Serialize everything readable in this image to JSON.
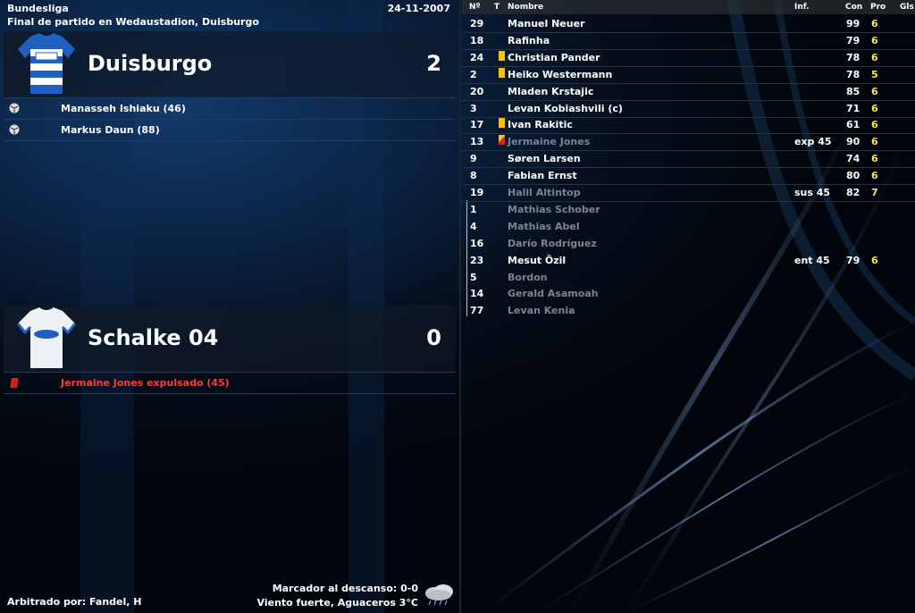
{
  "competition": "Bundesliga",
  "date": "24-11-2007",
  "subtitle": "Final de partido en Wedaustadion, Duisburgo",
  "home": {
    "name": "Duisburgo",
    "score": "2",
    "events": [
      {
        "icon": "ball-icon",
        "text": "Manasseh Ishiaku (46)"
      },
      {
        "icon": "ball-icon",
        "text": "Markus Daun (88)"
      }
    ]
  },
  "away": {
    "name": "Schalke 04",
    "score": "0",
    "events": [
      {
        "icon": "red-card-icon",
        "text": "Jermaine Jones expulsado (45)"
      }
    ]
  },
  "footer": {
    "referee": "Arbitrado por: Fandel, H",
    "halftime": "Marcador al descanso: 0-0",
    "weather": "Viento fuerte, Aguaceros 3°C",
    "weather_icon": "rain-cloud-icon"
  },
  "colors": {
    "red_text": "#ff3b2f",
    "rating": "#ffe84a"
  },
  "table": {
    "headers": {
      "num": "Nº",
      "t": "T",
      "name": "Nombre",
      "inf": "Inf.",
      "con": "Con",
      "pro": "Pro",
      "gls": "Gls"
    },
    "rows": [
      {
        "num": "29",
        "card": "",
        "name": "Manuel Neuer",
        "inf": "",
        "con": "99",
        "pro": "6",
        "dim": false
      },
      {
        "num": "18",
        "card": "",
        "name": "Rafinha",
        "inf": "",
        "con": "79",
        "pro": "6",
        "dim": false
      },
      {
        "num": "24",
        "card": "yellow",
        "name": "Christian Pander",
        "inf": "",
        "con": "78",
        "pro": "6",
        "dim": false
      },
      {
        "num": "2",
        "card": "yellow",
        "name": "Heiko Westermann",
        "inf": "",
        "con": "78",
        "pro": "5",
        "dim": false
      },
      {
        "num": "20",
        "card": "",
        "name": "Mladen Krstajic",
        "inf": "",
        "con": "85",
        "pro": "6",
        "dim": false
      },
      {
        "num": "3",
        "card": "",
        "name": "Levan Kobiashvili (c)",
        "inf": "",
        "con": "71",
        "pro": "6",
        "dim": false
      },
      {
        "num": "17",
        "card": "yellow",
        "name": "Ivan Rakitic",
        "inf": "",
        "con": "61",
        "pro": "6",
        "dim": false
      },
      {
        "num": "13",
        "card": "red",
        "name": "Jermaine Jones",
        "inf": "exp 45",
        "con": "90",
        "pro": "6",
        "dim": true
      },
      {
        "num": "9",
        "card": "",
        "name": "Søren Larsen",
        "inf": "",
        "con": "74",
        "pro": "6",
        "dim": false
      },
      {
        "num": "8",
        "card": "",
        "name": "Fabian Ernst",
        "inf": "",
        "con": "80",
        "pro": "6",
        "dim": false
      },
      {
        "num": "19",
        "card": "",
        "name": "Halil Altintop",
        "inf": "sus 45",
        "con": "82",
        "pro": "7",
        "dim": true
      },
      {
        "num": "1",
        "card": "",
        "name": "Mathias Schober",
        "inf": "",
        "con": "",
        "pro": "",
        "dim": true
      },
      {
        "num": "4",
        "card": "",
        "name": "Mathias Abel",
        "inf": "",
        "con": "",
        "pro": "",
        "dim": true
      },
      {
        "num": "16",
        "card": "",
        "name": "Darío Rodríguez",
        "inf": "",
        "con": "",
        "pro": "",
        "dim": true
      },
      {
        "num": "23",
        "card": "",
        "name": "Mesut Özil",
        "inf": "ent 45",
        "con": "79",
        "pro": "6",
        "dim": false
      },
      {
        "num": "5",
        "card": "",
        "name": "Bordon",
        "inf": "",
        "con": "",
        "pro": "",
        "dim": true
      },
      {
        "num": "14",
        "card": "",
        "name": "Gerald Asamoah",
        "inf": "",
        "con": "",
        "pro": "",
        "dim": true
      },
      {
        "num": "77",
        "card": "",
        "name": "Levan Kenia",
        "inf": "",
        "con": "",
        "pro": "",
        "dim": true
      }
    ]
  }
}
